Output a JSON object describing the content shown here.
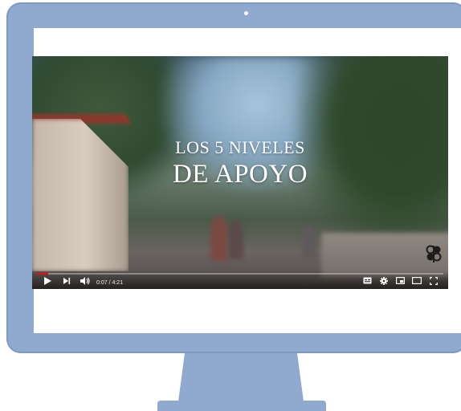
{
  "video": {
    "title_line1": "LOS 5 NIVELES",
    "title_line2": "DE APOYO",
    "time_display": "0:07 / 4:21",
    "progress": 0.027,
    "progress_color": "#ff0000",
    "controls": [
      "play-icon",
      "next-icon",
      "volume-icon",
      "subtitles-icon",
      "settings-icon",
      "miniplayer-icon",
      "theater-icon",
      "fullscreen-icon"
    ],
    "watermark": "channel-logo"
  },
  "colors": {
    "monitor": "#8fa9cf",
    "screen": "#ffffff"
  }
}
